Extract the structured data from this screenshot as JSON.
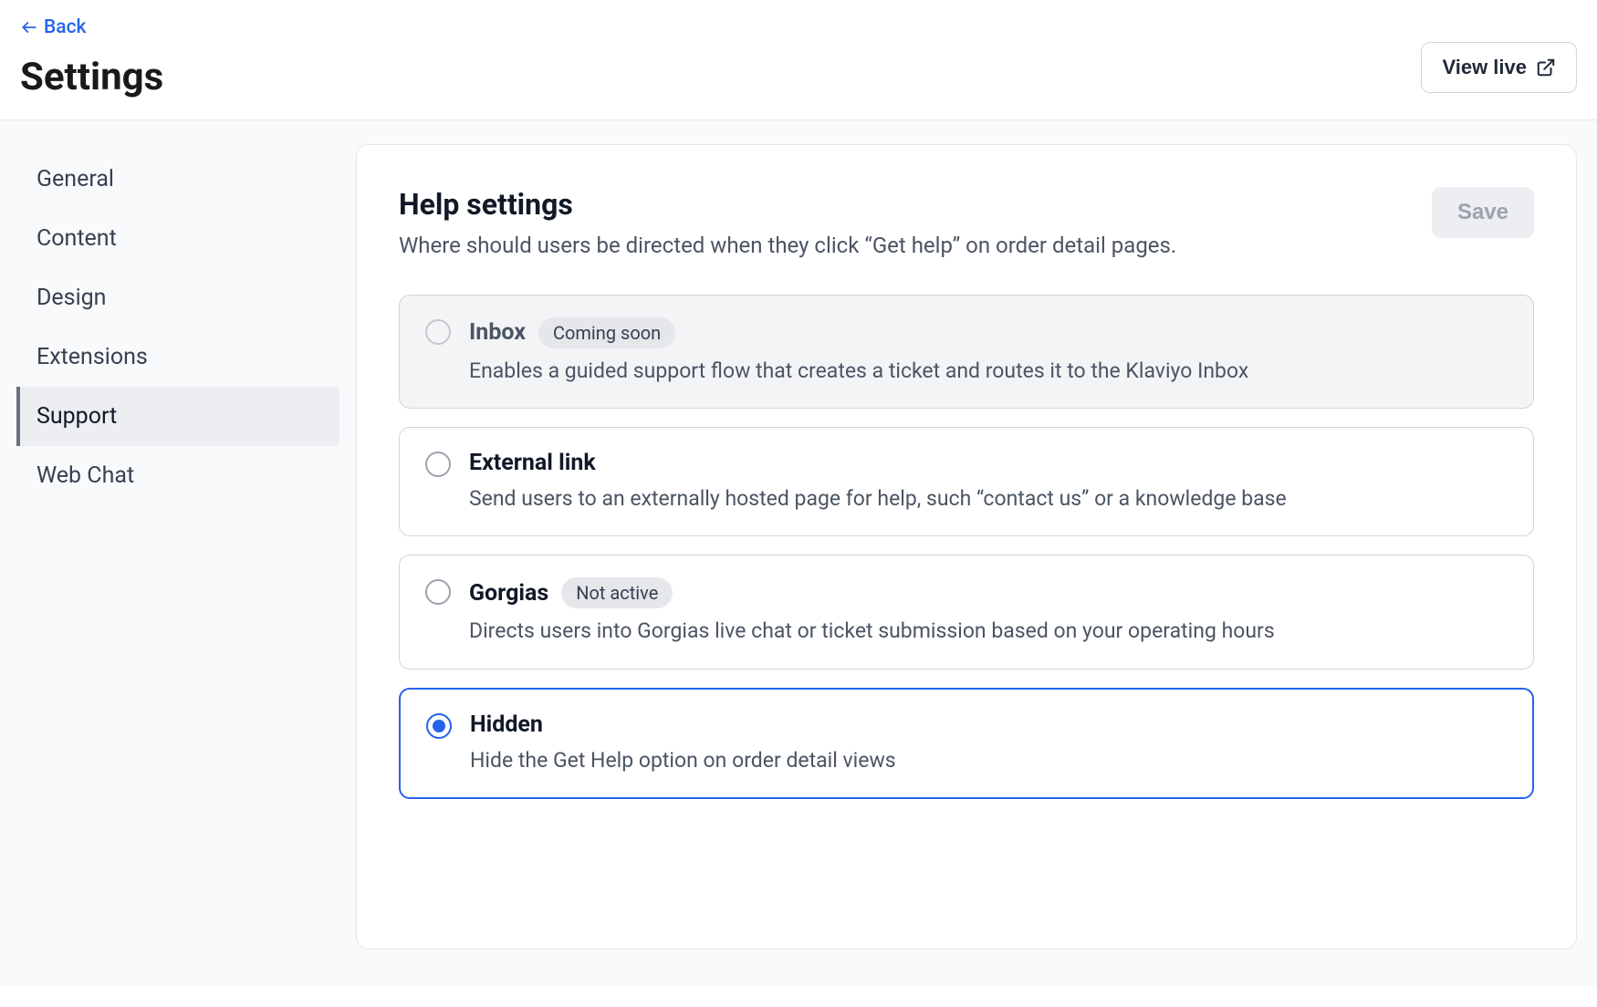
{
  "back_label": "Back",
  "page_title": "Settings",
  "view_live_label": "View live",
  "sidebar": {
    "items": [
      {
        "label": "General",
        "id": "general",
        "active": false
      },
      {
        "label": "Content",
        "id": "content",
        "active": false
      },
      {
        "label": "Design",
        "id": "design",
        "active": false
      },
      {
        "label": "Extensions",
        "id": "extensions",
        "active": false
      },
      {
        "label": "Support",
        "id": "support",
        "active": true
      },
      {
        "label": "Web Chat",
        "id": "web-chat",
        "active": false
      }
    ]
  },
  "card": {
    "title": "Help settings",
    "subtitle": "Where should users be directed when they click “Get help” on order detail pages.",
    "save_label": "Save",
    "save_disabled": true
  },
  "options": [
    {
      "id": "inbox",
      "title": "Inbox",
      "badge": "Coming soon",
      "desc": "Enables a guided support flow that creates a ticket and routes it to the Klaviyo Inbox",
      "disabled": true,
      "selected": false
    },
    {
      "id": "external-link",
      "title": "External link",
      "badge": null,
      "desc": "Send users to an externally hosted page for help, such “contact us” or a knowledge base",
      "disabled": false,
      "selected": false
    },
    {
      "id": "gorgias",
      "title": "Gorgias",
      "badge": "Not active",
      "desc": "Directs users into Gorgias live chat or ticket submission based on your operating hours",
      "disabled": false,
      "selected": false
    },
    {
      "id": "hidden",
      "title": "Hidden",
      "badge": null,
      "desc": "Hide the Get Help option on order detail views",
      "disabled": false,
      "selected": true
    }
  ]
}
